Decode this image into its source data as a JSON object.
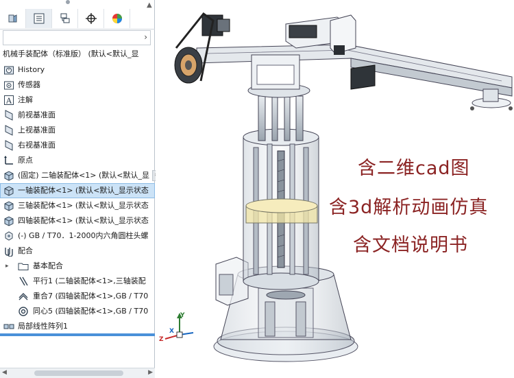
{
  "feature_tree": {
    "root_label": "机械手装配体（标准版） (默认<默认_显",
    "items": [
      {
        "label": "History",
        "icon": "history-icon",
        "level": 0
      },
      {
        "label": "传感器",
        "icon": "sensor-icon",
        "level": 0
      },
      {
        "label": "注解",
        "icon": "annotation-icon",
        "level": 0
      },
      {
        "label": "前视基准面",
        "icon": "plane-icon",
        "level": 0
      },
      {
        "label": "上视基准面",
        "icon": "plane-icon",
        "level": 0
      },
      {
        "label": "右视基准面",
        "icon": "plane-icon",
        "level": 0
      },
      {
        "label": "原点",
        "icon": "origin-icon",
        "level": 0
      },
      {
        "label": "(固定) 二轴装配体<1> (默认<默认_显",
        "icon": "subassembly-icon",
        "level": 0
      },
      {
        "label": "一轴装配体<1> (默认<默认_显示状态",
        "icon": "subassembly-icon",
        "level": 0,
        "selected": true
      },
      {
        "label": "三轴装配体<1> (默认<默认_显示状态",
        "icon": "subassembly-icon",
        "level": 0
      },
      {
        "label": "四轴装配体<1> (默认<默认_显示状态",
        "icon": "subassembly-icon",
        "level": 0
      },
      {
        "label": "(-) GB / T70．1-2000内六角圆柱头螺",
        "icon": "part-icon",
        "level": 0
      },
      {
        "label": "配合",
        "icon": "mates-icon",
        "level": 0
      },
      {
        "label": "基本配合",
        "icon": "folder-icon",
        "level": 1,
        "expander": "▸"
      },
      {
        "label": "平行1 (二轴装配体<1>,三轴装配",
        "icon": "parallel-mate-icon",
        "level": 1
      },
      {
        "label": "重合7 (四轴装配体<1>,GB / T70",
        "icon": "coincident-mate-icon",
        "level": 1
      },
      {
        "label": "同心5 (四轴装配体<1>,GB / T70",
        "icon": "concentric-mate-icon",
        "level": 1
      },
      {
        "label": "局部线性阵列1",
        "icon": "linear-pattern-icon",
        "level": 0
      }
    ]
  },
  "captions": [
    "含二维cad图",
    "含3d解析动画仿真",
    "含文档说明书"
  ],
  "triad": {
    "x": "X",
    "y": "Y",
    "z": "Z"
  },
  "colors": {
    "caption": "#8b2323",
    "selection": "#cce3f7",
    "accent": "#4a90d9"
  }
}
